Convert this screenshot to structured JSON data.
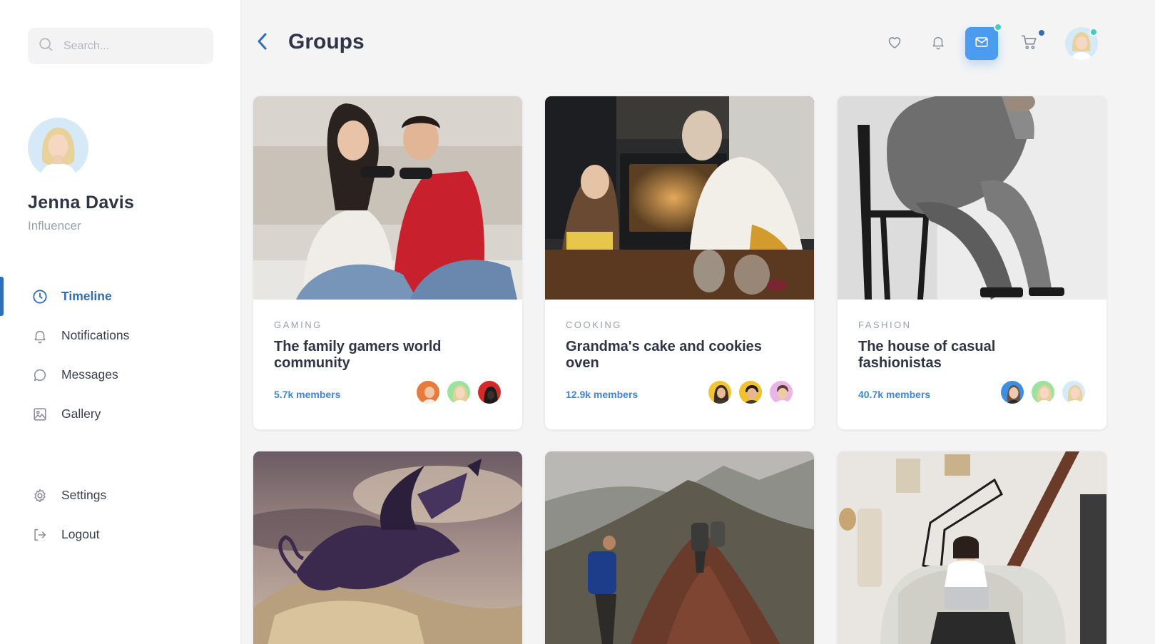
{
  "search": {
    "placeholder": "Search..."
  },
  "profile": {
    "name": "Jenna Davis",
    "role": "Influencer"
  },
  "nav": {
    "items": [
      {
        "label": "Timeline",
        "icon": "clock-icon",
        "active": true
      },
      {
        "label": "Notifications",
        "icon": "bell-icon",
        "active": false
      },
      {
        "label": "Messages",
        "icon": "chat-bubble-icon",
        "active": false
      },
      {
        "label": "Gallery",
        "icon": "image-icon",
        "active": false
      }
    ],
    "bottom": [
      {
        "label": "Settings",
        "icon": "gear-icon"
      },
      {
        "label": "Logout",
        "icon": "logout-icon"
      }
    ]
  },
  "header": {
    "title": "Groups",
    "icons": [
      "heart-icon",
      "bell-icon",
      "mail-icon",
      "cart-icon"
    ]
  },
  "colors": {
    "accent": "#2f6fb8",
    "mail_button": "#4b9bf0",
    "badge_teal": "#3ed0c2",
    "badge_blue": "#2f6fb8",
    "members_link": "#3f86d6"
  },
  "groups": [
    {
      "category": "GAMING",
      "title": "The family gamers world community",
      "members": "5.7k members"
    },
    {
      "category": "COOKING",
      "title": "Grandma's cake and cookies oven",
      "members": "12.9k members"
    },
    {
      "category": "FASHION",
      "title": "The house of casual fashionistas",
      "members": "40.7k members"
    }
  ]
}
